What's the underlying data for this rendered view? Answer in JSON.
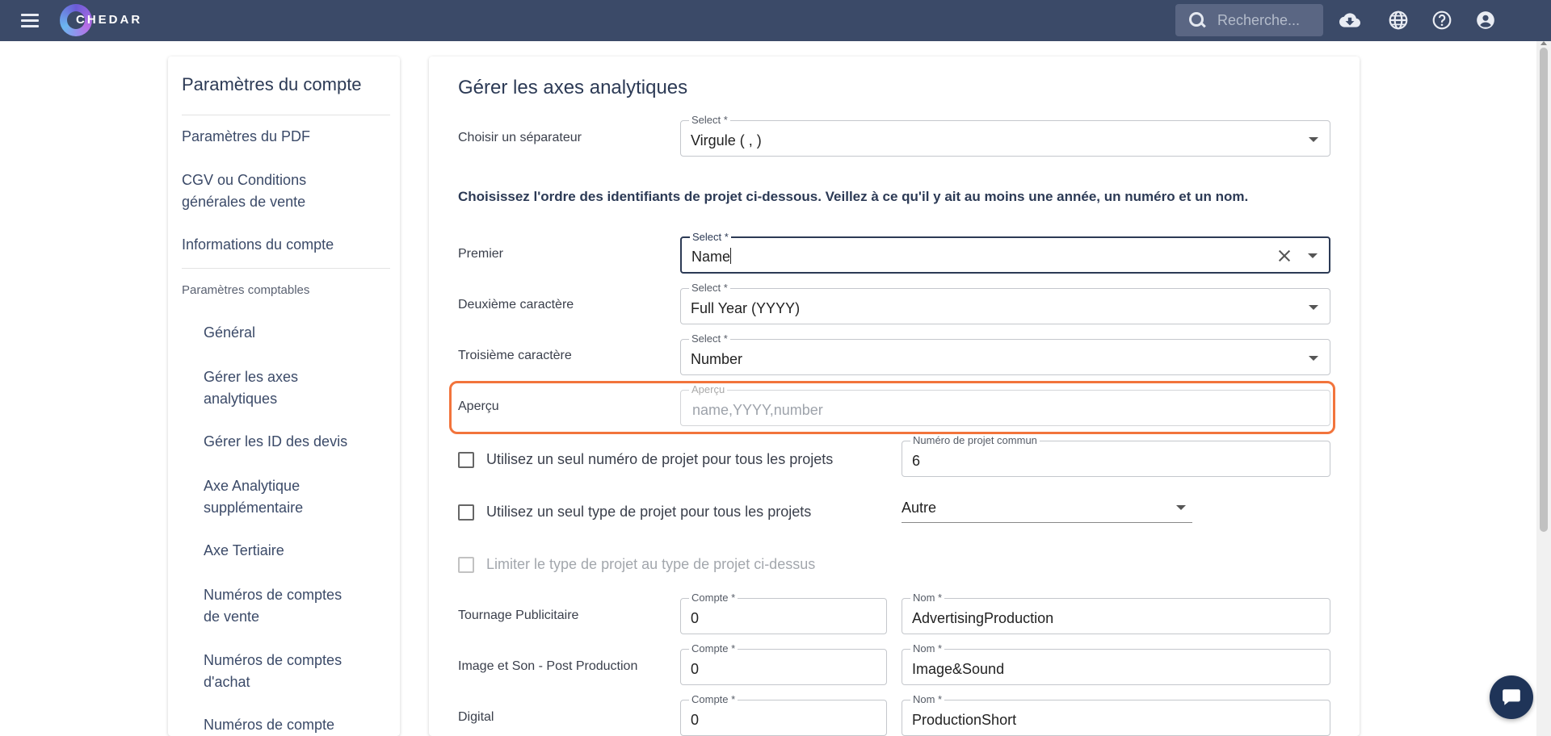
{
  "topbar": {
    "logo_text": "CHEDAR",
    "search_placeholder": "Recherche...",
    "icons": [
      "menu-icon",
      "download-cloud-icon",
      "globe-icon",
      "help-icon",
      "account-icon"
    ],
    "background_color": "#3b4a68"
  },
  "sidebar": {
    "title": "Paramètres du compte",
    "items": [
      {
        "label": "Paramètres du PDF"
      },
      {
        "label": "CGV ou Conditions générales de vente"
      },
      {
        "label": "Informations du compte"
      }
    ],
    "section_label": "Paramètres comptables",
    "sub_items": [
      {
        "label": "Général"
      },
      {
        "label": "Gérer les axes analytiques"
      },
      {
        "label": "Gérer les ID des devis"
      },
      {
        "label": "Axe Analytique supplémentaire"
      },
      {
        "label": "Axe Tertiaire"
      },
      {
        "label": "Numéros de comptes de vente"
      },
      {
        "label": "Numéros de comptes d'achat"
      },
      {
        "label": "Numéros de compte"
      }
    ]
  },
  "main": {
    "title": "Gérer les axes analytiques",
    "separator": {
      "label": "Choisir un séparateur",
      "legend": "Select *",
      "value": "Virgule ( , )"
    },
    "instruction": "Choisissez l'ordre des identifiants de projet ci-dessous. Veillez à ce qu'il y ait au moins une année, un numéro et un nom.",
    "first": {
      "label": "Premier",
      "legend": "Select *",
      "value": "Name"
    },
    "second": {
      "label": "Deuxième caractère",
      "legend": "Select *",
      "value": "Full Year (YYYY)"
    },
    "third": {
      "label": "Troisième caractère",
      "legend": "Select *",
      "value": "Number"
    },
    "preview": {
      "label": "Aperçu",
      "legend": "Aperçu",
      "value": "name,YYYY,number"
    },
    "single_number": {
      "label": "Utilisez un seul numéro de projet pour tous les projets",
      "field_legend": "Numéro de projet commun",
      "field_value": "6",
      "checked": false
    },
    "single_type": {
      "label": "Utilisez un seul type de projet pour tous les projets",
      "select_value": "Autre",
      "checked": false
    },
    "limit_type": {
      "label": "Limiter le type de projet au type de projet ci-dessus",
      "disabled": true
    },
    "project_types": [
      {
        "label": "Tournage Publicitaire",
        "compte_legend": "Compte *",
        "compte": "0",
        "nom_legend": "Nom *",
        "nom": "AdvertisingProduction"
      },
      {
        "label": "Image et Son - Post Production",
        "compte_legend": "Compte *",
        "compte": "0",
        "nom_legend": "Nom *",
        "nom": "Image&Sound"
      },
      {
        "label": "Digital",
        "compte_legend": "Compte *",
        "compte": "0",
        "nom_legend": "Nom *",
        "nom": "ProductionShort"
      }
    ],
    "highlight_color": "#f2743c"
  }
}
